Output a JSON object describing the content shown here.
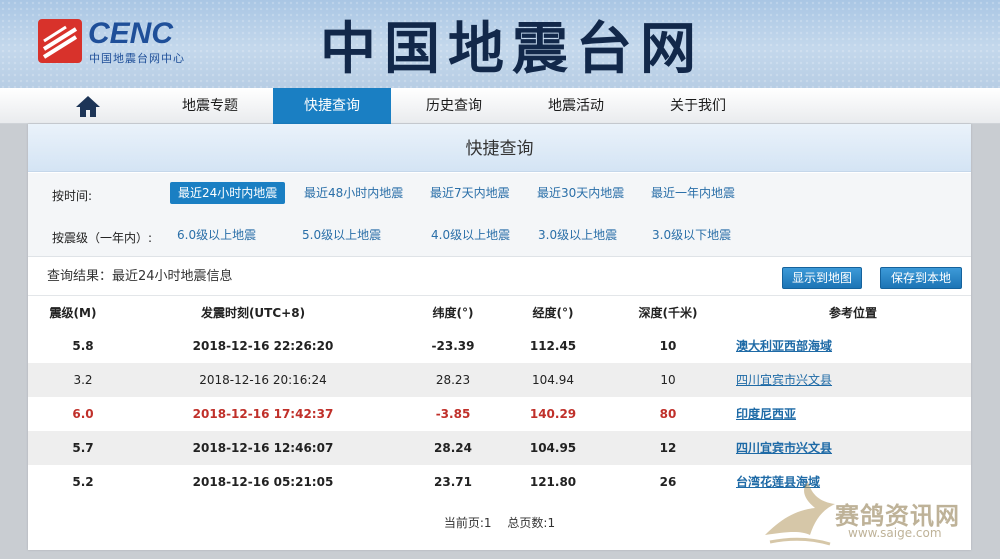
{
  "header": {
    "logo_en": "CENC",
    "logo_cn": "中国地震台网中心",
    "site_title": "中国地震台网"
  },
  "nav": {
    "items": [
      {
        "label": "地震专题"
      },
      {
        "label": "快捷查询",
        "active": true
      },
      {
        "label": "历史查询"
      },
      {
        "label": "地震活动"
      },
      {
        "label": "关于我们"
      }
    ]
  },
  "panel": {
    "title": "快捷查询",
    "filters": {
      "time_label": "按时间:",
      "time_options": [
        "最近24小时内地震",
        "最近48小时内地震",
        "最近7天内地震",
        "最近30天内地震",
        "最近一年内地震"
      ],
      "mag_label": "按震级（一年内）:",
      "mag_options": [
        "6.0级以上地震",
        "5.0级以上地震",
        "4.0级以上地震",
        "3.0级以上地震",
        "3.0级以下地震"
      ]
    },
    "result_text": "查询结果：最近24小时地震信息",
    "buttons": {
      "show_map": "显示到地图",
      "save_local": "保存到本地"
    },
    "table": {
      "headers": [
        "震级(M)",
        "发震时刻(UTC+8)",
        "纬度(°)",
        "经度(°)",
        "深度(千米)",
        "参考位置"
      ],
      "rows": [
        [
          "5.8",
          "2018-12-16 22:26:20",
          "-23.39",
          "112.45",
          "10",
          "澳大利亚西部海域"
        ],
        [
          "3.2",
          "2018-12-16 20:16:24",
          "28.23",
          "104.94",
          "10",
          "四川宜宾市兴文县"
        ],
        [
          "6.0",
          "2018-12-16 17:42:37",
          "-3.85",
          "140.29",
          "80",
          "印度尼西亚"
        ],
        [
          "5.7",
          "2018-12-16 12:46:07",
          "28.24",
          "104.95",
          "12",
          "四川宜宾市兴文县"
        ],
        [
          "5.2",
          "2018-12-16 05:21:05",
          "23.71",
          "121.80",
          "26",
          "台湾花莲县海域"
        ]
      ]
    },
    "pager": {
      "current": "当前页:1",
      "total": "总页数:1"
    }
  },
  "watermark": {
    "text": "赛鸽资讯网",
    "url": "www.saige.com"
  },
  "colors": {
    "accent": "#1a7fc3",
    "highlight_row_text": "#c0302a",
    "link": "#1e6aa6"
  }
}
